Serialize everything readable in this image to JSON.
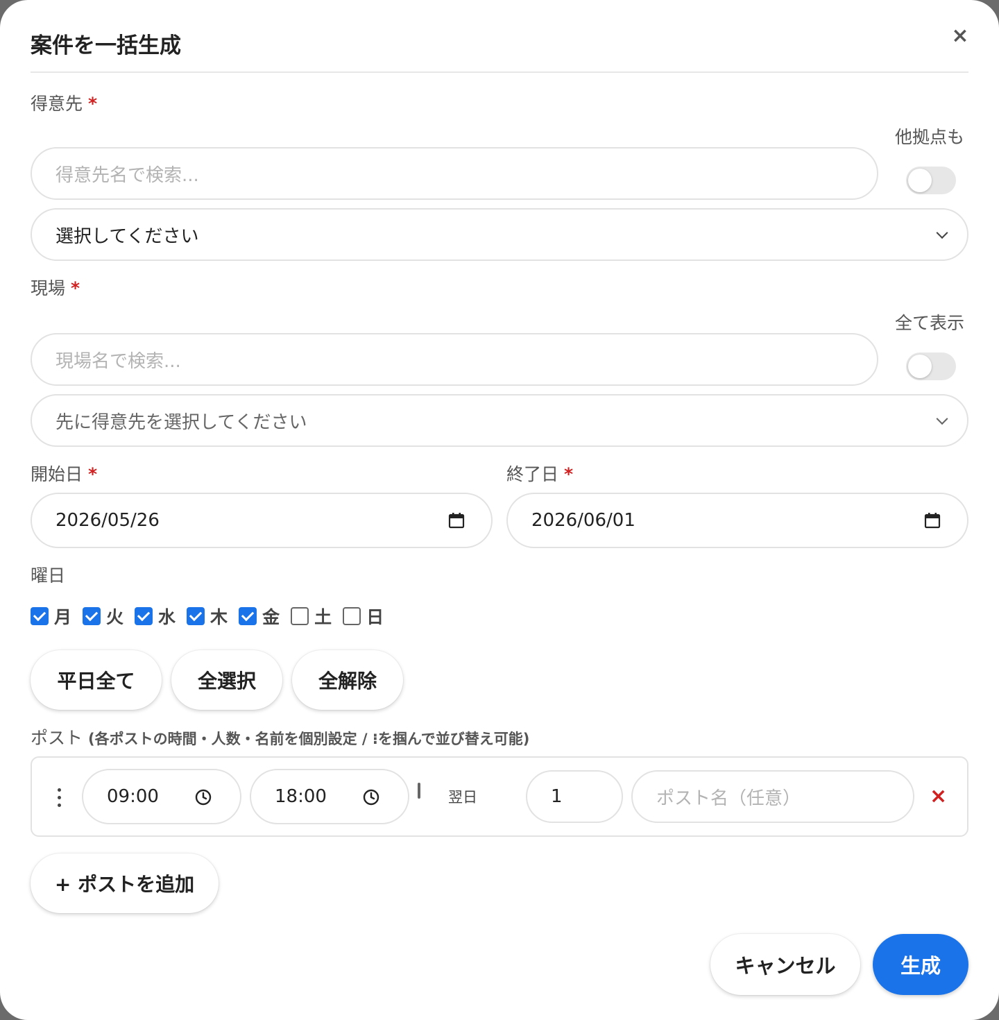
{
  "dialog": {
    "title": "案件を一括生成",
    "close_symbol": "×",
    "close_icon": "close-icon"
  },
  "client": {
    "label": "得意先",
    "required_mark": "*",
    "search_placeholder": "得意先名で検索...",
    "toggle_label": "他拠点も",
    "toggle_on": false,
    "select_value": "選択してください"
  },
  "site": {
    "label": "現場",
    "required_mark": "*",
    "search_placeholder": "現場名で検索...",
    "toggle_label": "全て表示",
    "toggle_on": false,
    "select_value": "先に得意先を選択してください"
  },
  "dates": {
    "start_label": "開始日",
    "start_value": "2026/05/26",
    "end_label": "終了日",
    "end_value": "2026/06/01",
    "required_mark": "*"
  },
  "weekdays": {
    "label": "曜日",
    "days": [
      {
        "label": "月",
        "checked": true
      },
      {
        "label": "火",
        "checked": true
      },
      {
        "label": "水",
        "checked": true
      },
      {
        "label": "木",
        "checked": true
      },
      {
        "label": "金",
        "checked": true
      },
      {
        "label": "土",
        "checked": false
      },
      {
        "label": "日",
        "checked": false
      }
    ],
    "buttons": {
      "weekdays_all": "平日全て",
      "select_all": "全選択",
      "deselect_all": "全解除"
    }
  },
  "posts": {
    "label": "ポスト",
    "hint": "(各ポストの時間・人数・名前を個別設定 / ⁝を掴んで並び替え可能)",
    "rows": [
      {
        "start_time": "09:00",
        "end_time": "18:00",
        "next_day_label": "翌日",
        "next_day": false,
        "count": "1",
        "name_placeholder": "ポスト名（任意）",
        "remove_symbol": "×"
      }
    ],
    "add_button": "+ ポストを追加"
  },
  "footer": {
    "cancel": "キャンセル",
    "create": "生成"
  },
  "colors": {
    "primary": "#1a73e8",
    "required": "#d02020",
    "border": "#e2e2e2"
  }
}
